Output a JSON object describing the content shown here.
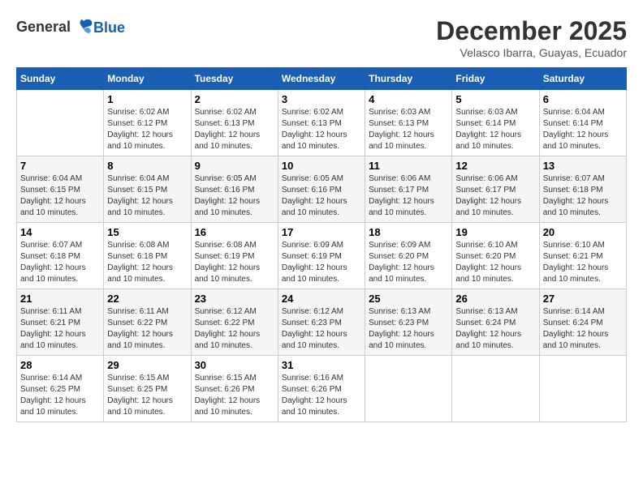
{
  "header": {
    "logo_line1": "General",
    "logo_line2": "Blue",
    "month_title": "December 2025",
    "subtitle": "Velasco Ibarra, Guayas, Ecuador"
  },
  "calendar": {
    "days_of_week": [
      "Sunday",
      "Monday",
      "Tuesday",
      "Wednesday",
      "Thursday",
      "Friday",
      "Saturday"
    ],
    "weeks": [
      [
        {
          "day": "",
          "sunrise": "",
          "sunset": "",
          "daylight": ""
        },
        {
          "day": "1",
          "sunrise": "Sunrise: 6:02 AM",
          "sunset": "Sunset: 6:12 PM",
          "daylight": "Daylight: 12 hours and 10 minutes."
        },
        {
          "day": "2",
          "sunrise": "Sunrise: 6:02 AM",
          "sunset": "Sunset: 6:13 PM",
          "daylight": "Daylight: 12 hours and 10 minutes."
        },
        {
          "day": "3",
          "sunrise": "Sunrise: 6:02 AM",
          "sunset": "Sunset: 6:13 PM",
          "daylight": "Daylight: 12 hours and 10 minutes."
        },
        {
          "day": "4",
          "sunrise": "Sunrise: 6:03 AM",
          "sunset": "Sunset: 6:13 PM",
          "daylight": "Daylight: 12 hours and 10 minutes."
        },
        {
          "day": "5",
          "sunrise": "Sunrise: 6:03 AM",
          "sunset": "Sunset: 6:14 PM",
          "daylight": "Daylight: 12 hours and 10 minutes."
        },
        {
          "day": "6",
          "sunrise": "Sunrise: 6:04 AM",
          "sunset": "Sunset: 6:14 PM",
          "daylight": "Daylight: 12 hours and 10 minutes."
        }
      ],
      [
        {
          "day": "7",
          "sunrise": "Sunrise: 6:04 AM",
          "sunset": "Sunset: 6:15 PM",
          "daylight": "Daylight: 12 hours and 10 minutes."
        },
        {
          "day": "8",
          "sunrise": "Sunrise: 6:04 AM",
          "sunset": "Sunset: 6:15 PM",
          "daylight": "Daylight: 12 hours and 10 minutes."
        },
        {
          "day": "9",
          "sunrise": "Sunrise: 6:05 AM",
          "sunset": "Sunset: 6:16 PM",
          "daylight": "Daylight: 12 hours and 10 minutes."
        },
        {
          "day": "10",
          "sunrise": "Sunrise: 6:05 AM",
          "sunset": "Sunset: 6:16 PM",
          "daylight": "Daylight: 12 hours and 10 minutes."
        },
        {
          "day": "11",
          "sunrise": "Sunrise: 6:06 AM",
          "sunset": "Sunset: 6:17 PM",
          "daylight": "Daylight: 12 hours and 10 minutes."
        },
        {
          "day": "12",
          "sunrise": "Sunrise: 6:06 AM",
          "sunset": "Sunset: 6:17 PM",
          "daylight": "Daylight: 12 hours and 10 minutes."
        },
        {
          "day": "13",
          "sunrise": "Sunrise: 6:07 AM",
          "sunset": "Sunset: 6:18 PM",
          "daylight": "Daylight: 12 hours and 10 minutes."
        }
      ],
      [
        {
          "day": "14",
          "sunrise": "Sunrise: 6:07 AM",
          "sunset": "Sunset: 6:18 PM",
          "daylight": "Daylight: 12 hours and 10 minutes."
        },
        {
          "day": "15",
          "sunrise": "Sunrise: 6:08 AM",
          "sunset": "Sunset: 6:18 PM",
          "daylight": "Daylight: 12 hours and 10 minutes."
        },
        {
          "day": "16",
          "sunrise": "Sunrise: 6:08 AM",
          "sunset": "Sunset: 6:19 PM",
          "daylight": "Daylight: 12 hours and 10 minutes."
        },
        {
          "day": "17",
          "sunrise": "Sunrise: 6:09 AM",
          "sunset": "Sunset: 6:19 PM",
          "daylight": "Daylight: 12 hours and 10 minutes."
        },
        {
          "day": "18",
          "sunrise": "Sunrise: 6:09 AM",
          "sunset": "Sunset: 6:20 PM",
          "daylight": "Daylight: 12 hours and 10 minutes."
        },
        {
          "day": "19",
          "sunrise": "Sunrise: 6:10 AM",
          "sunset": "Sunset: 6:20 PM",
          "daylight": "Daylight: 12 hours and 10 minutes."
        },
        {
          "day": "20",
          "sunrise": "Sunrise: 6:10 AM",
          "sunset": "Sunset: 6:21 PM",
          "daylight": "Daylight: 12 hours and 10 minutes."
        }
      ],
      [
        {
          "day": "21",
          "sunrise": "Sunrise: 6:11 AM",
          "sunset": "Sunset: 6:21 PM",
          "daylight": "Daylight: 12 hours and 10 minutes."
        },
        {
          "day": "22",
          "sunrise": "Sunrise: 6:11 AM",
          "sunset": "Sunset: 6:22 PM",
          "daylight": "Daylight: 12 hours and 10 minutes."
        },
        {
          "day": "23",
          "sunrise": "Sunrise: 6:12 AM",
          "sunset": "Sunset: 6:22 PM",
          "daylight": "Daylight: 12 hours and 10 minutes."
        },
        {
          "day": "24",
          "sunrise": "Sunrise: 6:12 AM",
          "sunset": "Sunset: 6:23 PM",
          "daylight": "Daylight: 12 hours and 10 minutes."
        },
        {
          "day": "25",
          "sunrise": "Sunrise: 6:13 AM",
          "sunset": "Sunset: 6:23 PM",
          "daylight": "Daylight: 12 hours and 10 minutes."
        },
        {
          "day": "26",
          "sunrise": "Sunrise: 6:13 AM",
          "sunset": "Sunset: 6:24 PM",
          "daylight": "Daylight: 12 hours and 10 minutes."
        },
        {
          "day": "27",
          "sunrise": "Sunrise: 6:14 AM",
          "sunset": "Sunset: 6:24 PM",
          "daylight": "Daylight: 12 hours and 10 minutes."
        }
      ],
      [
        {
          "day": "28",
          "sunrise": "Sunrise: 6:14 AM",
          "sunset": "Sunset: 6:25 PM",
          "daylight": "Daylight: 12 hours and 10 minutes."
        },
        {
          "day": "29",
          "sunrise": "Sunrise: 6:15 AM",
          "sunset": "Sunset: 6:25 PM",
          "daylight": "Daylight: 12 hours and 10 minutes."
        },
        {
          "day": "30",
          "sunrise": "Sunrise: 6:15 AM",
          "sunset": "Sunset: 6:26 PM",
          "daylight": "Daylight: 12 hours and 10 minutes."
        },
        {
          "day": "31",
          "sunrise": "Sunrise: 6:16 AM",
          "sunset": "Sunset: 6:26 PM",
          "daylight": "Daylight: 12 hours and 10 minutes."
        },
        {
          "day": "",
          "sunrise": "",
          "sunset": "",
          "daylight": ""
        },
        {
          "day": "",
          "sunrise": "",
          "sunset": "",
          "daylight": ""
        },
        {
          "day": "",
          "sunrise": "",
          "sunset": "",
          "daylight": ""
        }
      ]
    ]
  }
}
